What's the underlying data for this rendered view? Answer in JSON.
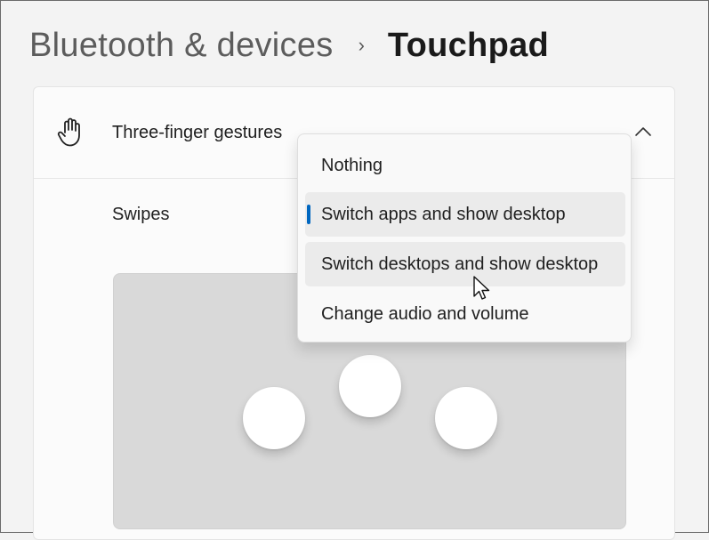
{
  "breadcrumb": {
    "parent": "Bluetooth & devices",
    "separator": "›",
    "current": "Touchpad"
  },
  "gestures_card": {
    "icon": "hand-icon",
    "title": "Three-finger gestures",
    "expanded": true,
    "swipes_label": "Swipes"
  },
  "dropdown": {
    "options": [
      {
        "label": "Nothing",
        "selected": false,
        "hovered": false
      },
      {
        "label": "Switch apps and show desktop",
        "selected": true,
        "hovered": false
      },
      {
        "label": "Switch desktops and show desktop",
        "selected": false,
        "hovered": true
      },
      {
        "label": "Change audio and volume",
        "selected": false,
        "hovered": false
      }
    ]
  },
  "colors": {
    "accent": "#0067c0",
    "background": "#f3f3f3",
    "card": "#fbfbfb",
    "preview": "#d9d9d9"
  }
}
